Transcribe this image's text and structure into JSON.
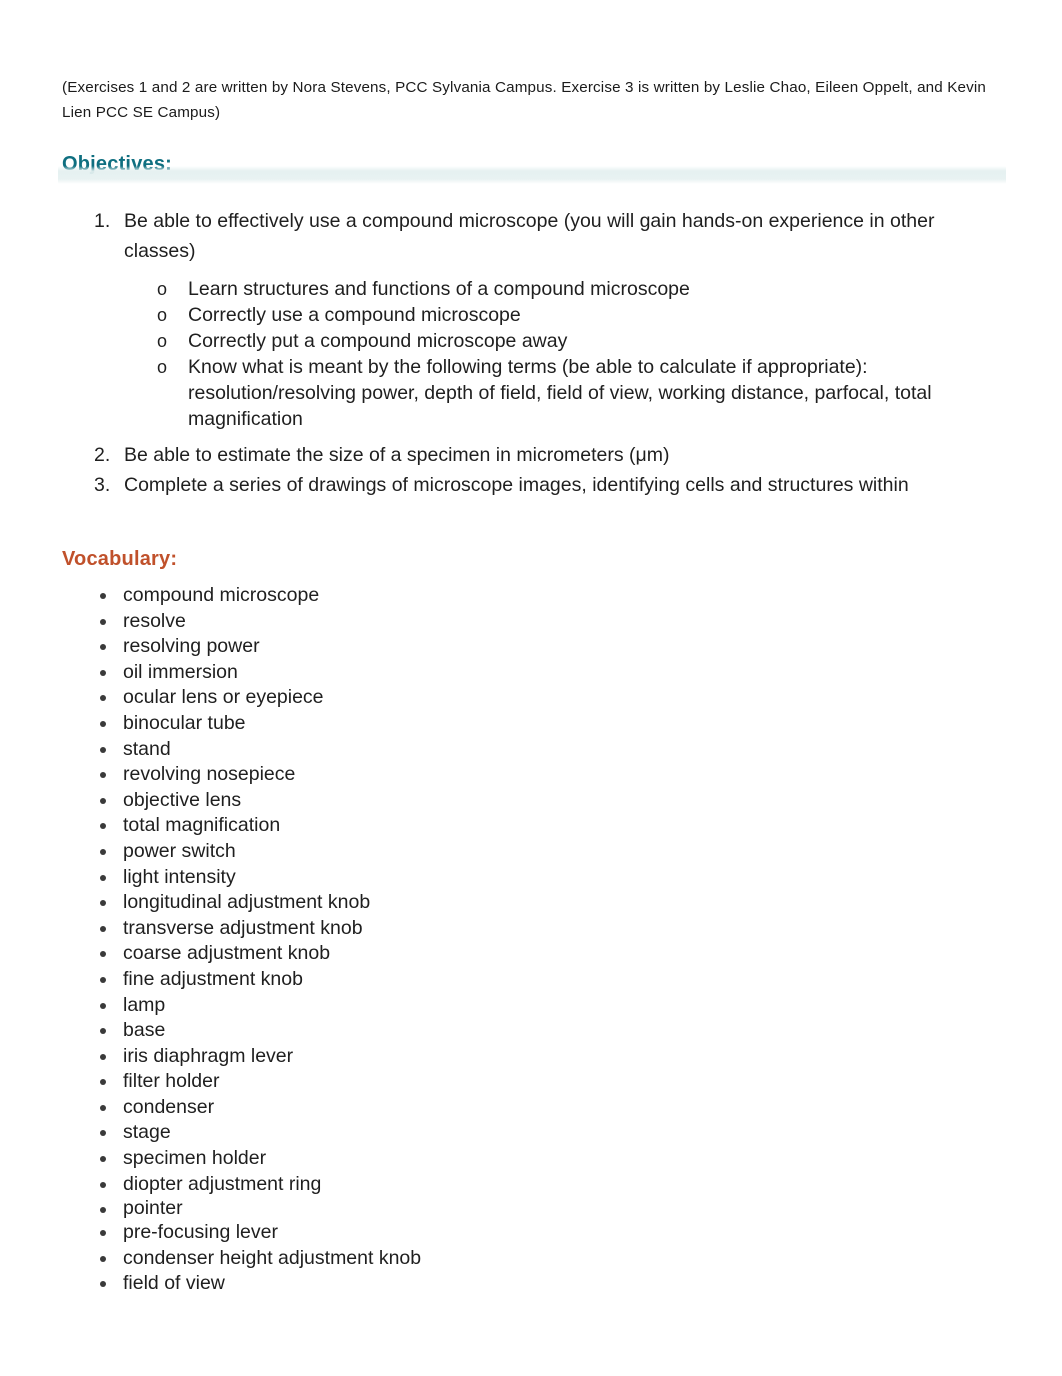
{
  "document": {
    "attribution": "(Exercises 1 and 2 are written by Nora Stevens, PCC Sylvania Campus. Exercise 3 is written by Leslie Chao, Eileen Oppelt, and Kevin Lien PCC SE Campus)",
    "colors": {
      "objectives_heading": "#0f6f80",
      "vocabulary_heading": "#c0512b",
      "body_text": "#1f1f1f",
      "highlight_band": "#e4f0f0",
      "page_background": "#ffffff"
    }
  },
  "objectives": {
    "heading": "Objectives:",
    "items": [
      {
        "number": "1.",
        "text": "Be able to effectively use a compound microscope (you will gain hands-on experience in other classes)",
        "sub_marker": "o",
        "sub_items": [
          "Learn structures and functions of a compound microscope",
          "Correctly use a compound microscope",
          "Correctly put a compound microscope away",
          "Know what is meant by the following terms (be able to calculate if appropriate): resolution/resolving power, depth of field, field of view, working distance, parfocal, total magnification"
        ]
      },
      {
        "number": "2.",
        "text": "Be able to estimate the size of a specimen in micrometers (μm)",
        "sub_items": []
      },
      {
        "number": "3.",
        "text": "Complete a series of drawings of microscope images, identifying cells and structures within",
        "sub_items": []
      }
    ]
  },
  "vocabulary": {
    "heading": "Vocabulary:",
    "terms": [
      "compound microscope",
      "resolve",
      "resolving power",
      "oil immersion",
      "ocular lens or eyepiece",
      "binocular tube",
      "stand",
      "revolving nosepiece",
      "objective lens",
      "total magnification",
      "power switch",
      "light intensity",
      "longitudinal adjustment knob",
      "transverse adjustment knob",
      "coarse adjustment knob",
      "fine adjustment knob",
      "lamp",
      "base",
      "iris diaphragm lever",
      "filter holder",
      "condenser",
      "stage",
      "specimen holder",
      "diopter adjustment ring",
      "pointer",
      "pre-focusing lever",
      "condenser height adjustment knob",
      "field of view"
    ]
  }
}
